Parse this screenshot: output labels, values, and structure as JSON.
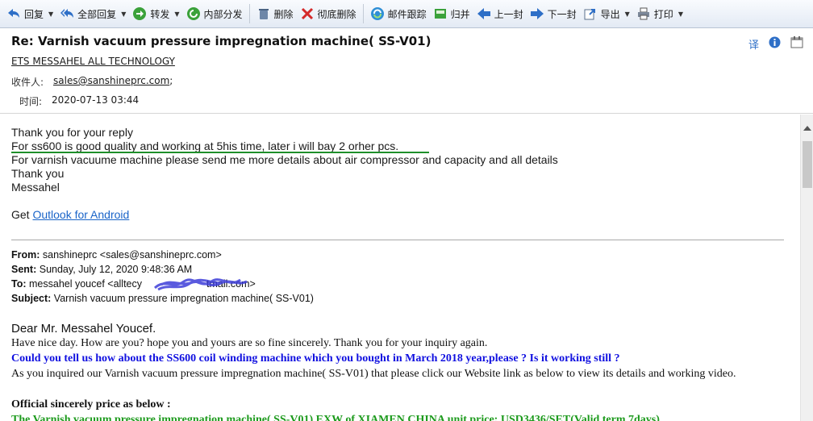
{
  "toolbar": {
    "reply": "回复",
    "reply_all": "全部回复",
    "forward": "转发",
    "internal_forward": "内部分发",
    "delete": "删除",
    "delete_permanent": "彻底删除",
    "track": "邮件跟踪",
    "archive": "归并",
    "prev": "上一封",
    "next": "下一封",
    "export": "导出",
    "print": "打印"
  },
  "header": {
    "subject": "Re: Varnish vacuum pressure impregnation machine( SS-V01)",
    "sender": "ETS MESSAHEL ALL TECHNOLOGY",
    "to_label": "收件人:",
    "to_value": "sales@sanshineprc.com",
    "to_suffix": ";",
    "time_label": "时间:",
    "time_value": "2020-07-13 03:44",
    "translate": "译"
  },
  "reply": {
    "line1": "Thank you for your reply",
    "line2": "For ss600 is good quality and working at 5his time,  later i will  bay 2 orher pcs.",
    "line3": "For varnish vacuume machine please send me more details about air compressor and capacity  and all details",
    "line4": "Thank you",
    "line5": "Messahel",
    "get": "Get",
    "outlook": "Outlook for Android"
  },
  "quoted": {
    "from_label": "From:",
    "from_value": "sanshineprc <sales@sanshineprc.com>",
    "sent_label": "Sent:",
    "sent_value": "Sunday, July 12, 2020 9:48:36 AM",
    "to_label": "To:",
    "to_value": "messahel youcef <alltecy",
    "to_value_tail": "tmail.com>",
    "subject_label": "Subject:",
    "subject_value": "Varnish vacuum pressure impregnation machine( SS-V01)",
    "greeting": "Dear Mr. Messahel Youcef.",
    "p1": "Have nice day. How are you? hope you and yours are so fine sincerely. Thank you for your inquiry again.",
    "p2": "Could you tell us how about the SS600 coil winding machine which you bought in March 2018 year,please ? Is it working still ?",
    "p3": "As you inquired our Varnish vacuum pressure impregnation machine( SS-V01) that please click our Website link as below to view its details and working video.",
    "price_heading": "Official sincerely price as below :",
    "price_line": "The Varnish vacuum pressure impregnation machine( SS-V01) EXW of XIAMEN CHINA unit price: USD3436/SET(Valid term 7days)"
  },
  "colors": {
    "blue_text": "#1010e0",
    "green_text": "#1c9a1c",
    "underline_green": "#1f8f2a",
    "scribble": "#3d3dd8"
  }
}
